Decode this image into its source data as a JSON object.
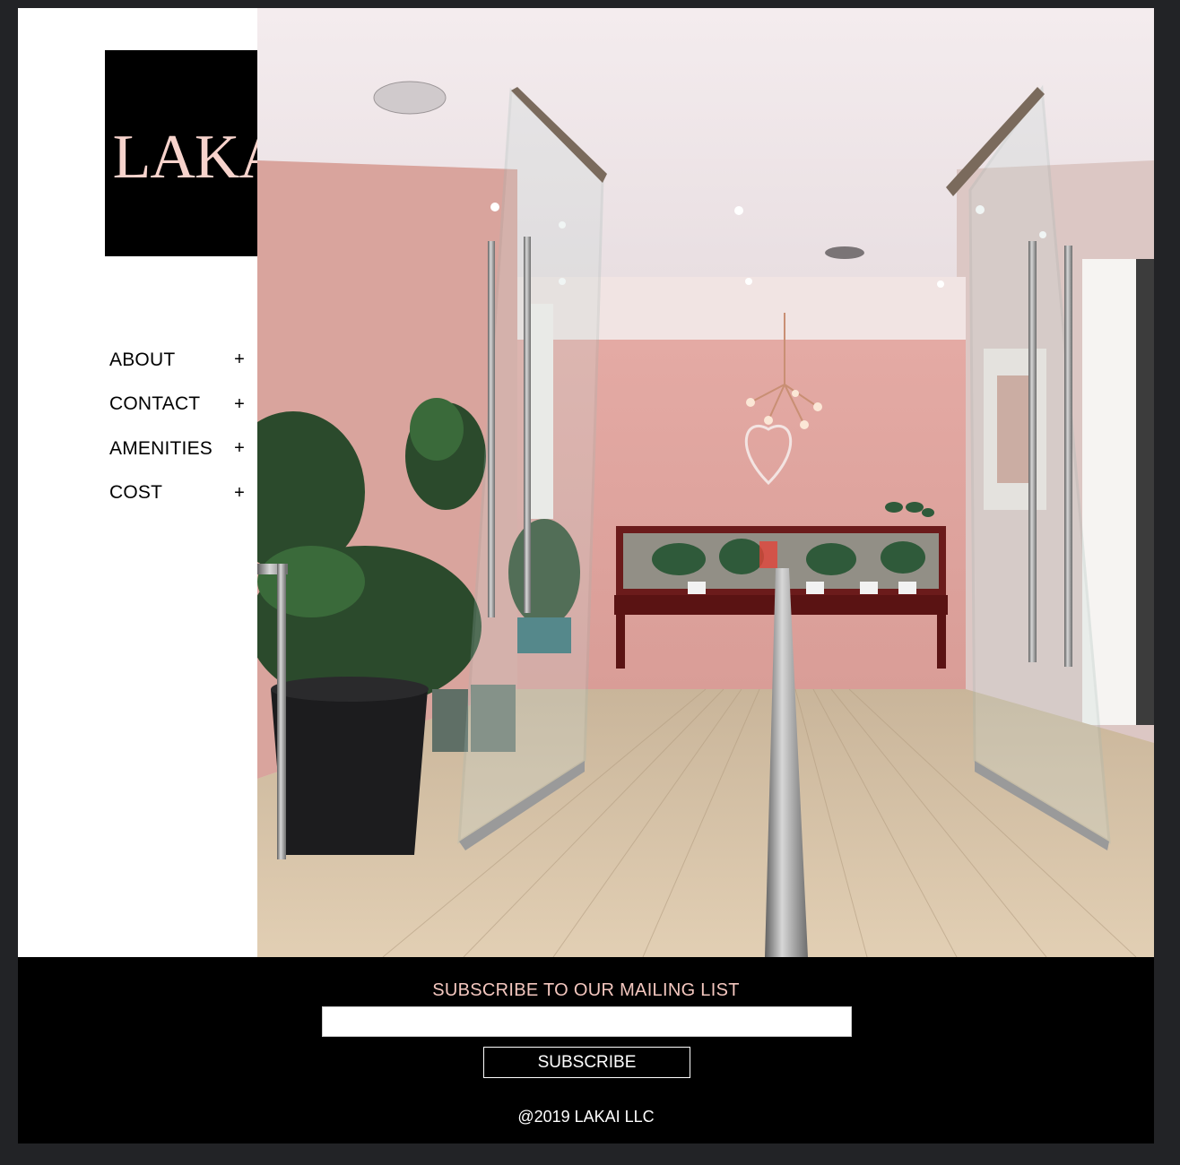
{
  "logo": {
    "text": "LAKAI"
  },
  "nav": {
    "items": [
      {
        "label": "ABOUT",
        "expand": "+"
      },
      {
        "label": "CONTACT",
        "expand": "+"
      },
      {
        "label": "AMENITIES",
        "expand": "+"
      },
      {
        "label": "COST",
        "expand": "+"
      }
    ]
  },
  "footer": {
    "subscribe_title": "SUBSCRIBE TO OUR MAILING LIST",
    "email_value": "",
    "subscribe_label": "SUBSCRIBE",
    "copyright": "@2019 LAKAI LLC"
  },
  "colors": {
    "accent_pink": "#f7d3cc",
    "footer_bg": "#000000",
    "page_bg": "#ffffff"
  }
}
